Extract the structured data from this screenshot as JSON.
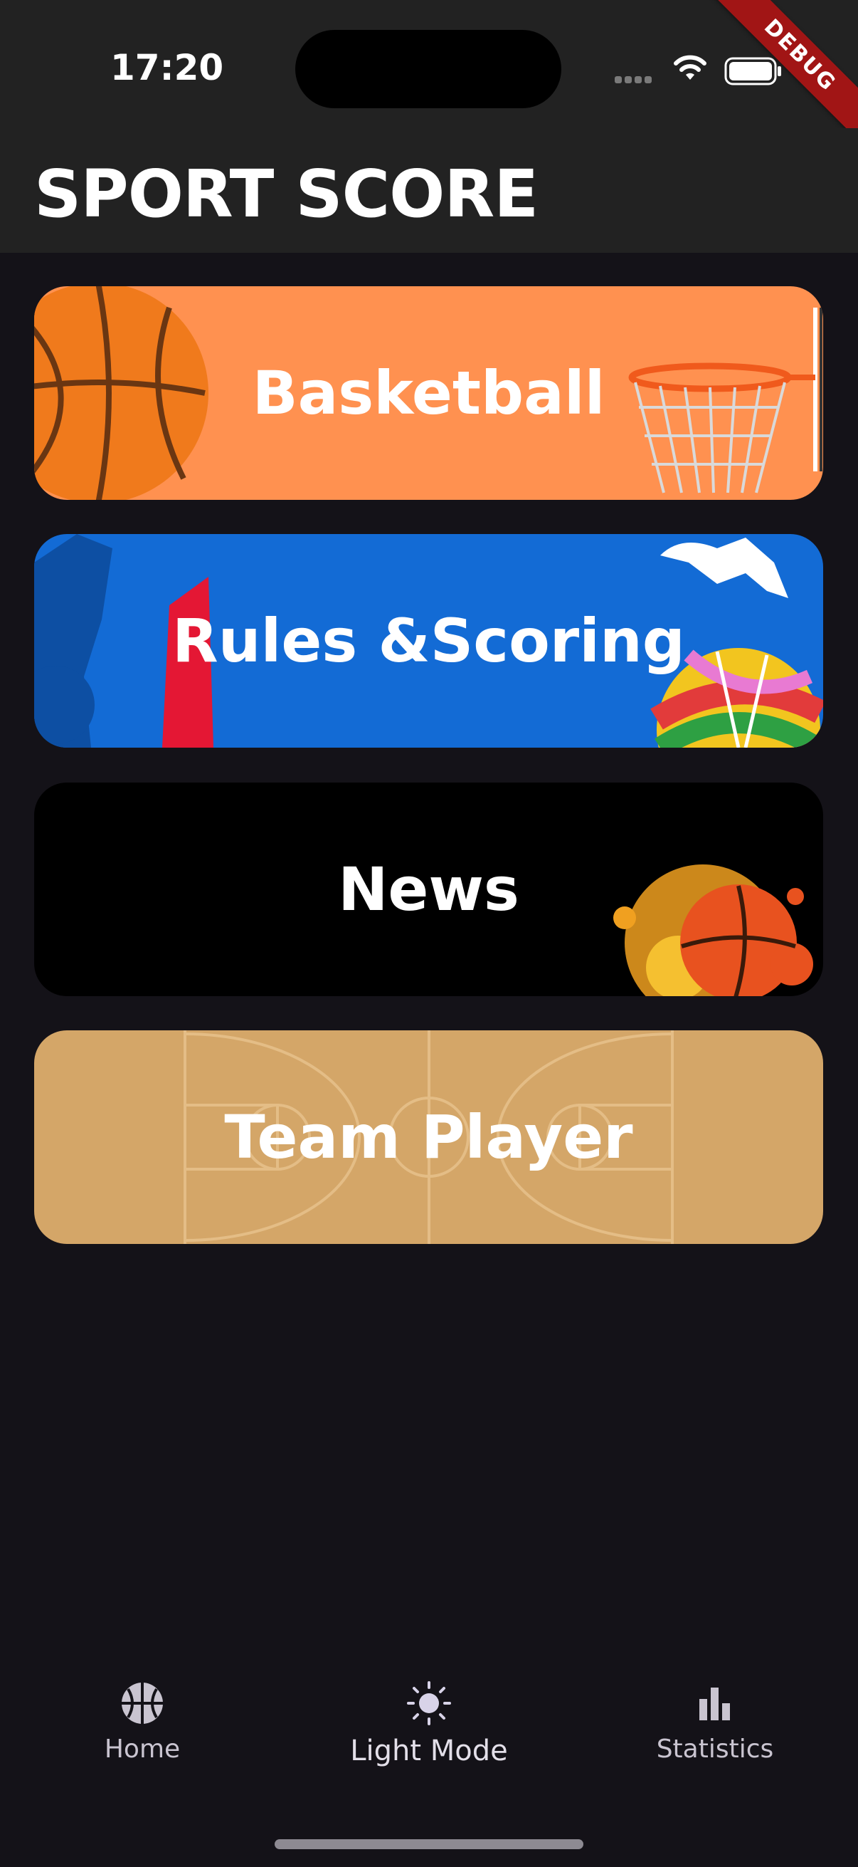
{
  "status_bar": {
    "time": "17:20",
    "debug_banner": "DEBUG",
    "icons": [
      "signal-dots-icon",
      "wifi-icon",
      "battery-icon"
    ]
  },
  "app_bar": {
    "title": "SPORT SCORE"
  },
  "cards": [
    {
      "label": "Basketball",
      "background": "#ff9150"
    },
    {
      "label": "Rules &Scoring",
      "background": "#136bd5"
    },
    {
      "label": "News",
      "background": "#000000"
    },
    {
      "label": "Team Player",
      "background": "#d4a668"
    }
  ],
  "bottom_nav": {
    "items": [
      {
        "label": "Home",
        "icon": "basketball-icon"
      },
      {
        "label": "Light Mode",
        "icon": "sun-icon"
      },
      {
        "label": "Statistics",
        "icon": "bar-chart-icon"
      }
    ]
  },
  "colors": {
    "background": "#141218",
    "app_bar": "#222222",
    "nav_icon": "#c9c4d0"
  }
}
